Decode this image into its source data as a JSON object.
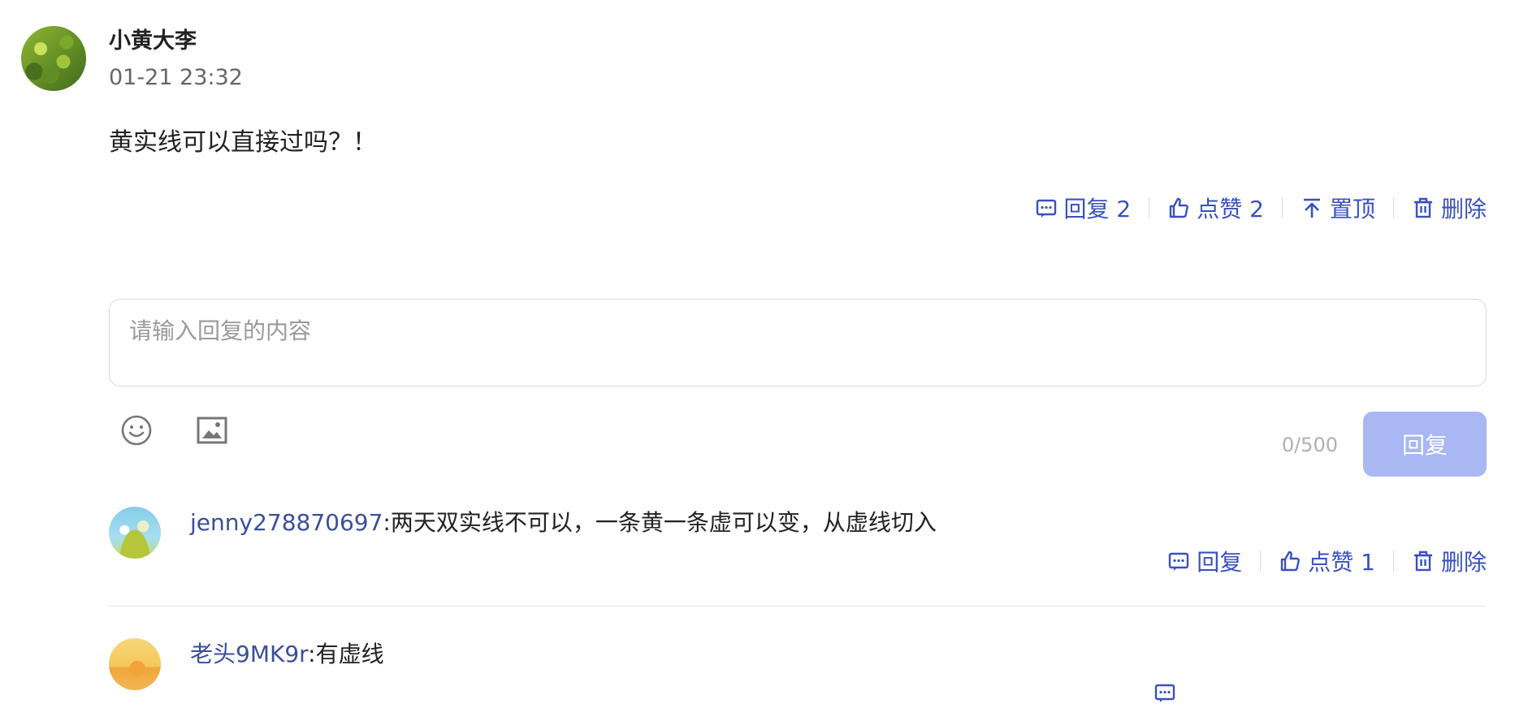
{
  "post": {
    "username": "小黄大李",
    "timestamp": "01-21 23:32",
    "content": "黄实线可以直接过吗？！",
    "actions": {
      "reply": "回复 2",
      "like": "点赞 2",
      "pin": "置顶",
      "delete": "删除"
    }
  },
  "reply_box": {
    "placeholder": "请输入回复的内容",
    "counter": "0/500",
    "submit": "回复"
  },
  "comments": [
    {
      "username": "jenny278870697",
      "separator": ":",
      "text": "两天双实线不可以，一条黄一条虚可以变，从虚线切入",
      "actions": {
        "reply": "回复",
        "like": "点赞 1",
        "delete": "删除"
      }
    },
    {
      "username": "老头9MK9r",
      "separator": ":",
      "text": "有虚线"
    }
  ],
  "colors": {
    "accent": "#3a50c0",
    "username_link": "#3a4f9a",
    "button_disabled": "#a9b7f3"
  }
}
